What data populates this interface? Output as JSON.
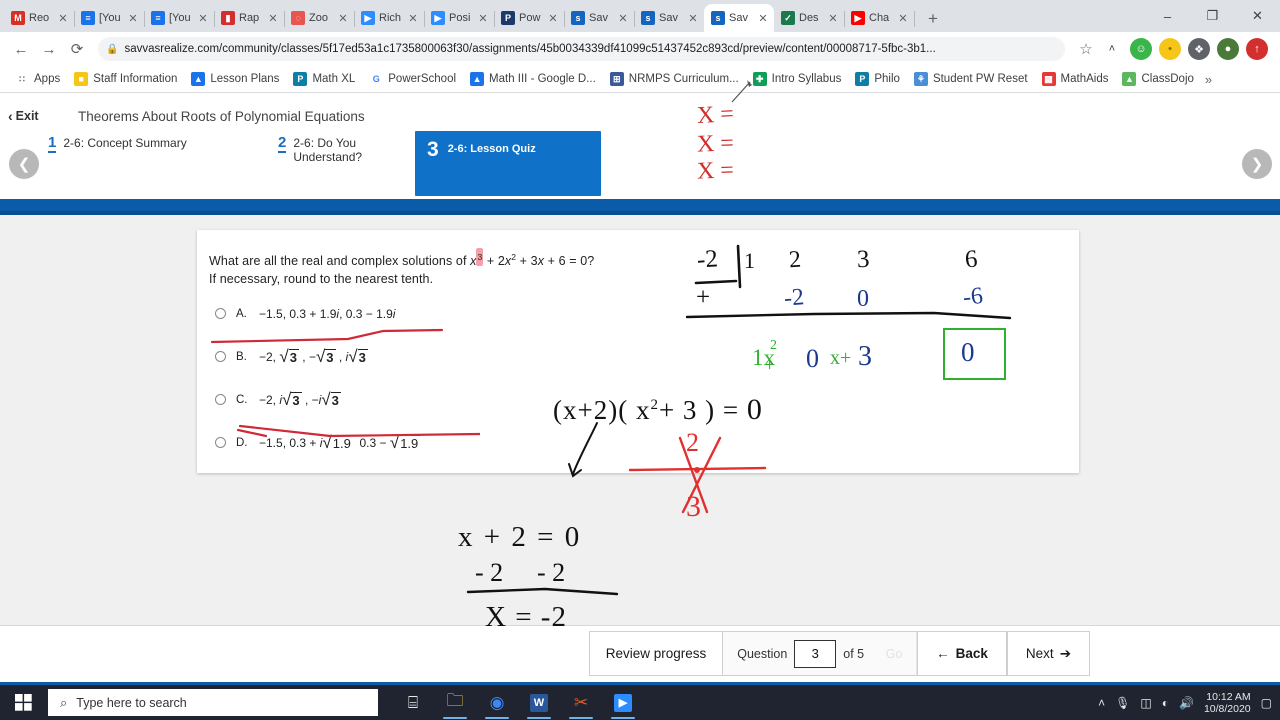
{
  "browser": {
    "tabs": [
      {
        "title": "Reo",
        "favicon": "gmail-icon",
        "color": "#d93025",
        "glyph": "M"
      },
      {
        "title": "[You",
        "favicon": "doc-icon",
        "color": "#1a73e8",
        "glyph": "≡"
      },
      {
        "title": "[You",
        "favicon": "doc-icon",
        "color": "#1a73e8",
        "glyph": "≡"
      },
      {
        "title": "Rap",
        "favicon": "book-icon",
        "color": "#d32f2f",
        "glyph": "▮"
      },
      {
        "title": "Zoo",
        "favicon": "loading-icon",
        "color": "#e8554e",
        "glyph": "◌"
      },
      {
        "title": "Rich",
        "favicon": "video-icon",
        "color": "#2d8cff",
        "glyph": "▶"
      },
      {
        "title": "Posi",
        "favicon": "video-icon",
        "color": "#2d8cff",
        "glyph": "▶"
      },
      {
        "title": "Pow",
        "favicon": "powerschool-icon",
        "color": "#1b3a6b",
        "glyph": "P"
      },
      {
        "title": "Sav",
        "favicon": "savvas-icon",
        "color": "#1565c0",
        "glyph": "s"
      },
      {
        "title": "Sav",
        "favicon": "savvas-icon",
        "color": "#1565c0",
        "glyph": "s"
      },
      {
        "title": "Sav",
        "favicon": "savvas-icon",
        "color": "#1565c0",
        "glyph": "s",
        "active": true
      },
      {
        "title": "Des",
        "favicon": "desmos-icon",
        "color": "#1a7a4c",
        "glyph": "✓"
      },
      {
        "title": "Cha",
        "favicon": "youtube-icon",
        "color": "#ff0000",
        "glyph": "▶"
      }
    ],
    "new_tab_label": "+",
    "window_controls": {
      "minimize": "–",
      "maximize": "❐",
      "close": "✕"
    },
    "nav": {
      "back": "←",
      "forward": "→",
      "reload": "⟳"
    },
    "url": "savvasrealize.com/community/classes/5f17ed53a1c1735800063f30/assignments/45b0034339df41099c51437452c893cd/preview/content/00008717-5fbc-3b1...",
    "lock_icon": "🔒",
    "star_icon": "☆",
    "toolbar_icons": [
      {
        "name": "caret-up-icon",
        "glyph": "˄",
        "color": "#3c4043",
        "bg": "transparent"
      },
      {
        "name": "green-app-icon",
        "glyph": "☺",
        "color": "#ffffff",
        "bg": "#3ab54a"
      },
      {
        "name": "emoji-extension-icon",
        "glyph": "•",
        "color": "#8a6d00",
        "bg": "#f5c518"
      },
      {
        "name": "puzzle-extension-icon",
        "glyph": "❖",
        "color": "#ffffff",
        "bg": "#5f6368"
      },
      {
        "name": "profile-avatar-icon",
        "glyph": "●",
        "color": "#ffffff",
        "bg": "#4a7a3a"
      },
      {
        "name": "opera-extension-icon",
        "glyph": "↑",
        "color": "#ffffff",
        "bg": "#d32f2f"
      }
    ],
    "bookmarks": [
      {
        "label": "Apps",
        "icon": "apps-grid-icon",
        "color": "#5f6368",
        "glyph": "∷"
      },
      {
        "label": "Staff Information",
        "icon": "folder-icon",
        "color": "#f5c518",
        "glyph": "■"
      },
      {
        "label": "Lesson Plans",
        "icon": "drive-icon",
        "color": "#1a73e8",
        "glyph": "▲"
      },
      {
        "label": "Math XL",
        "icon": "pearson-icon",
        "color": "#0d7fa5",
        "glyph": "P"
      },
      {
        "label": "PowerSchool",
        "icon": "google-icon",
        "color": "#ffffff",
        "glyph": "G"
      },
      {
        "label": "Math III - Google D...",
        "icon": "drive-icon",
        "color": "#1a73e8",
        "glyph": "▲"
      },
      {
        "label": "NRMPS Curriculum...",
        "icon": "calendar-icon",
        "color": "#3b5998",
        "glyph": "⊞"
      },
      {
        "label": "Intro Syllabus",
        "icon": "sheets-icon",
        "color": "#0f9d58",
        "glyph": "✚"
      },
      {
        "label": "Philo",
        "icon": "pearson-icon",
        "color": "#0d7fa5",
        "glyph": "P"
      },
      {
        "label": "Student PW Reset",
        "icon": "people-icon",
        "color": "#4a8fd6",
        "glyph": "⚘"
      },
      {
        "label": "MathAids",
        "icon": "grid-icon",
        "color": "#e53935",
        "glyph": "▦"
      },
      {
        "label": "ClassDojo",
        "icon": "classdojo-icon",
        "color": "#5cb85c",
        "glyph": "▲"
      }
    ],
    "bookmarks_overflow": "»"
  },
  "lesson": {
    "exit_label": "Exit",
    "exit_chevron": "‹",
    "title": "Theorems About Roots of Polynomial Equations",
    "prev_arrow": "❮",
    "next_arrow": "❯",
    "steps": [
      {
        "num": "1",
        "label": "2-6: Concept Summary"
      },
      {
        "num": "2",
        "label": "2-6: Do You Understand?"
      },
      {
        "num": "3",
        "label": "2-6: Lesson Quiz",
        "active": true
      }
    ],
    "accent_color": "#1071c8",
    "bar_color": "#0b5ca8"
  },
  "quiz": {
    "question_line1_a": "What are all the real and complex solutions of ",
    "question_var": "x",
    "question_sup": "3",
    "question_line1_b": " + 2",
    "question_var2": "x",
    "question_sup2": "2",
    "question_line1_c": " + 3",
    "question_var3": "x",
    "question_line1_d": " + 6 = 0?",
    "question_line2": "If necessary, round to the nearest tenth.",
    "options": [
      {
        "letter": "A.",
        "text": "−1.5, 0.3 + 1.9i, 0.3 − 1.9i"
      },
      {
        "letter": "B.",
        "text": "−2, √3 , −√3 , i√3"
      },
      {
        "letter": "C.",
        "text": "−2, i√3 , −i√3"
      },
      {
        "letter": "D.",
        "text": "−1.5, 0.3 + i√1.9 , 0.3 − √1.9"
      }
    ]
  },
  "toolbar": {
    "review_progress": "Review progress",
    "question_label": "Question",
    "question_number": "3",
    "of_label": "of 5",
    "go_label": "Go",
    "back_label": "Back",
    "back_arrow": "←",
    "next_label": "Next",
    "next_arrow": "➔"
  },
  "taskbar": {
    "search_placeholder": "Type here to search",
    "search_icon": "⚲",
    "start_icon": "windows-logo-icon",
    "apps": [
      {
        "name": "task-view-icon",
        "glyph": "⌸",
        "color": "#e8e8e8",
        "bg": "transparent"
      },
      {
        "name": "file-explorer-icon",
        "glyph": "🗀",
        "color": "#f0c14b",
        "bg": "transparent"
      },
      {
        "name": "chrome-icon",
        "glyph": "◉",
        "color": "#4285f4",
        "bg": "transparent"
      },
      {
        "name": "word-icon",
        "glyph": "W",
        "color": "#ffffff",
        "bg": "#2b579a"
      },
      {
        "name": "snipping-tool-icon",
        "glyph": "✂",
        "color": "#e05a2b",
        "bg": "transparent"
      },
      {
        "name": "zoom-icon",
        "glyph": "▶",
        "color": "#ffffff",
        "bg": "#2d8cff"
      }
    ],
    "tray": {
      "chevron": "˄",
      "mic": "🎙",
      "battery": "▬",
      "wifi": "◠",
      "volume": "🔊",
      "time": "10:12 AM",
      "date": "10/8/2020",
      "notifications": "▭"
    }
  },
  "annotations": {
    "roots_list": [
      "X =",
      "X =",
      "X ="
    ],
    "synthetic_divisor": "-2",
    "synthetic_row1": [
      "1",
      "2",
      "3",
      "6"
    ],
    "synthetic_plus": "+",
    "synthetic_row2": [
      "-2",
      "0",
      "-6"
    ],
    "quotient_coef": "1x",
    "quotient_sup": "2",
    "quotient_plus": "+",
    "quotient_zero": "0",
    "quotient_x": "x+",
    "quotient_const": "3",
    "remainder": "0",
    "factored": "(x+2)( x",
    "factored_sup": "2",
    "factored_rest": "+ 3 ) =",
    "factored_zero": "0",
    "cross_top": "2",
    "cross_bottom": "3",
    "solve_line1": "x + 2 = 0",
    "solve_line2a": "- 2",
    "solve_line2b": "- 2",
    "solve_line3": "X = -2",
    "ink_red": "#d32b2b",
    "ink_blue": "#1b3a8f",
    "ink_green": "#2fb02f",
    "ink_black": "#111111"
  }
}
